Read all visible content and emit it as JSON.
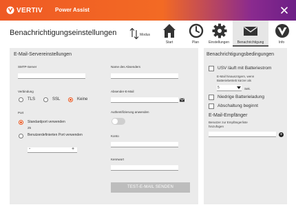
{
  "titlebar": {
    "logo": "VERTIV",
    "app_name": "Power Assist"
  },
  "header": {
    "page_title": "Benachrichtigungseinstellungen",
    "modus_label": "Modus",
    "nav": [
      {
        "label": "Start",
        "icon": "home-icon"
      },
      {
        "label": "Plan",
        "icon": "clock-icon"
      },
      {
        "label": "Einstellungen",
        "icon": "gear-icon"
      },
      {
        "label": "Benachrichtigung",
        "icon": "envelope-icon",
        "active": true
      },
      {
        "label": "Info",
        "icon": "vertiv-badge-icon"
      }
    ]
  },
  "email_server": {
    "title": "E-Mail-Servereinstellungen",
    "smtp_label": "SMTP-Server",
    "smtp_value": "",
    "connection_label": "Verbindung",
    "connection_options": [
      "TLS",
      "SSL",
      "Keine"
    ],
    "connection_selected": "Keine",
    "port_label": "Port",
    "port_default_label": "Standardport verwenden",
    "port_default_value": "25",
    "port_custom_label": "Benutzerdefinierten Port verwenden",
    "stepper_minus": "-",
    "stepper_plus": "+",
    "sender_name_label": "Name des Absenders",
    "sender_email_label": "Absender-E-Mail",
    "auth_label": "Authentifizierung anwenden",
    "auth_enabled": false,
    "account_label": "Konto",
    "password_label": "Kennwort",
    "test_button": "TEST-E-MAIL SENDEN"
  },
  "conditions": {
    "title": "Benachrichtigungsbedingungen",
    "battery_label": "USV läuft mit Batteriestrom",
    "battery_note": "E-Mail hinauszögern, wenn Batteriebetrieb kürzer als",
    "delay_value": "5",
    "delay_unit": "Sek.",
    "low_battery_label": "Niedrige Batterieladung",
    "shutdown_label": "Abschaltung beginnt",
    "recipients_title": "E-Mail-Empfänger",
    "recipients_hint": "Benutzer zur Empfängerliste hinzufügen",
    "add_symbol": "+"
  },
  "colors": {
    "accent": "#e8541c",
    "panel": "#ebebeb",
    "button_disabled": "#bdbdbd"
  }
}
